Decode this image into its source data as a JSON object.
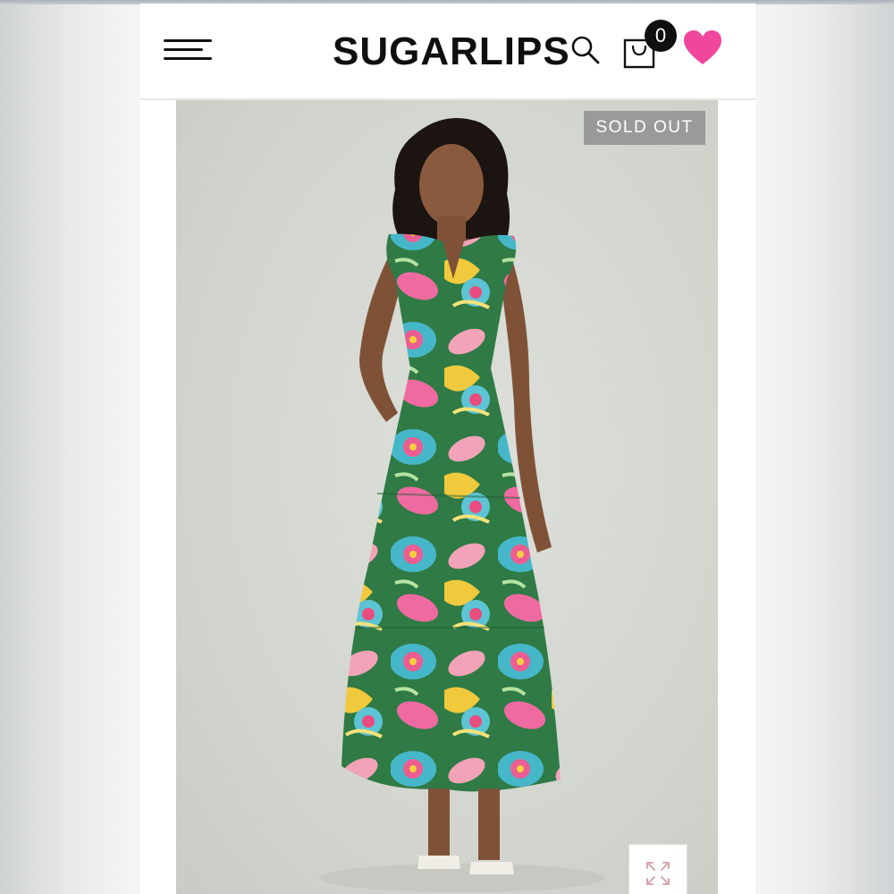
{
  "header": {
    "logo_text": "SUGARLIPS",
    "menu_icon": "hamburger-menu-icon",
    "search_icon": "search-icon",
    "cart_icon": "shopping-bag-icon",
    "cart_count": "0",
    "wishlist_icon": "heart-icon"
  },
  "product": {
    "badge": "SOLD OUT",
    "image": "model-in-floral-tiered-maxi-dress",
    "zoom_icon": "expand-icon"
  },
  "colors": {
    "brand_text": "#0f0f0f",
    "heart": "#f0479c",
    "badge_bg": "#9a9a9a",
    "header_bg": "#ffffff"
  }
}
